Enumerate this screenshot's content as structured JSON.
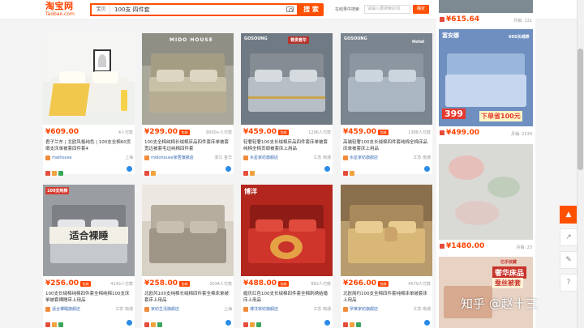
{
  "app": {
    "logo": "淘宝网",
    "logo_sub": "Taobao.com"
  },
  "search": {
    "scope": "宝贝",
    "query": "100支 四件套",
    "button_label": "搜 索",
    "store_search_label": "在结果中搜索",
    "store_search_placeholder": "请输入要搜索的词",
    "store_search_button": "确定"
  },
  "products": [
    {
      "price": "¥609.00",
      "sales": "4人付款",
      "title": "君子兰东 | 北欧风格纯色 | 100支全棉60贡缎支床单被套四件套4",
      "shop": "maihouse",
      "location": "上海",
      "has_tag": false
    },
    {
      "price": "¥299.00",
      "sales": "8000+人付款",
      "title": "100支全棉纯棉长绒棉床品四件套床单被套宽边被套毛边纯棉四件套",
      "shop": "midohouse家居旗舰店",
      "location": "浙江 金华",
      "has_tag": true,
      "img_logo": "MIDO HOUSE"
    },
    {
      "price": "¥459.00",
      "sales": "1296人付款",
      "title": "轻奢轻奢100支长绒棉床品四件套床单被套纯棉全棉贡缎被套床上用品",
      "shop": "水星家纺旗舰店",
      "location": "江苏 南通",
      "has_tag": true,
      "img_logo": "GOSOUNG",
      "img_badge": "尊贵套华"
    },
    {
      "price": "¥459.00",
      "sales": "1388人付款",
      "title": "高端轻奢100支长绒棉四件套纯棉全棉床品床单被套床上用品",
      "shop": "水星家纺旗舰店",
      "location": "江苏 南通",
      "has_tag": true,
      "img_logo": "GOSOUNG",
      "img_badge": "Hotel"
    },
    {
      "price": "¥256.00",
      "sales": "4143人付款",
      "title": "100支长绒棉纯棉四件套全棉纯棉100支床单被套裸睡床上用品",
      "shop": "适合裸睡旗舰店",
      "location": "江苏 南通",
      "has_tag": true,
      "img_badge": "100支纯棉",
      "img_text": "适合裸睡"
    },
    {
      "price": "¥258.00",
      "sales": "3034人付款",
      "title": "北欧风100支纯棉长绒棉四件套全棉床单被套床上用品",
      "shop": "家纺生活旗舰店",
      "location": "上海",
      "has_tag": true
    },
    {
      "price": "¥488.00",
      "sales": "892人付款",
      "title": "婚庆红色100支长绒棉四件套全棉刺绣结婚床上用品",
      "shop": "博洋家纺旗舰店",
      "location": "江苏 南通",
      "has_tag": true,
      "img_logo": "博洋"
    },
    {
      "price": "¥266.00",
      "sales": "4579人付款",
      "title": "北欧简约100支全棉四件套纯棉床单被套床上用品",
      "shop": "罗莱家纺旗舰店",
      "location": "江苏 南通",
      "has_tag": true
    }
  ],
  "right_column": [
    {
      "price": "¥615.64",
      "sales": "月销: 131"
    },
    {
      "price": "¥499.00",
      "sales": "月销: 2239",
      "img_logo": "富安娜",
      "img_badge": "60S长绒棉",
      "img_price_tag": "399",
      "img_banner": "下单省100元"
    },
    {
      "price": "¥1480.00",
      "sales": "月销: 23"
    },
    {
      "img_badge": "亿乐收藏",
      "img_title": "奢华床品",
      "img_banner": "蚕丝被套"
    }
  ],
  "side_toolbar": {
    "top_icon": "arrow-up-icon",
    "items": [
      "↗",
      "✎",
      "?",
      "⚙"
    ]
  },
  "watermark": "知乎 @赵十三"
}
